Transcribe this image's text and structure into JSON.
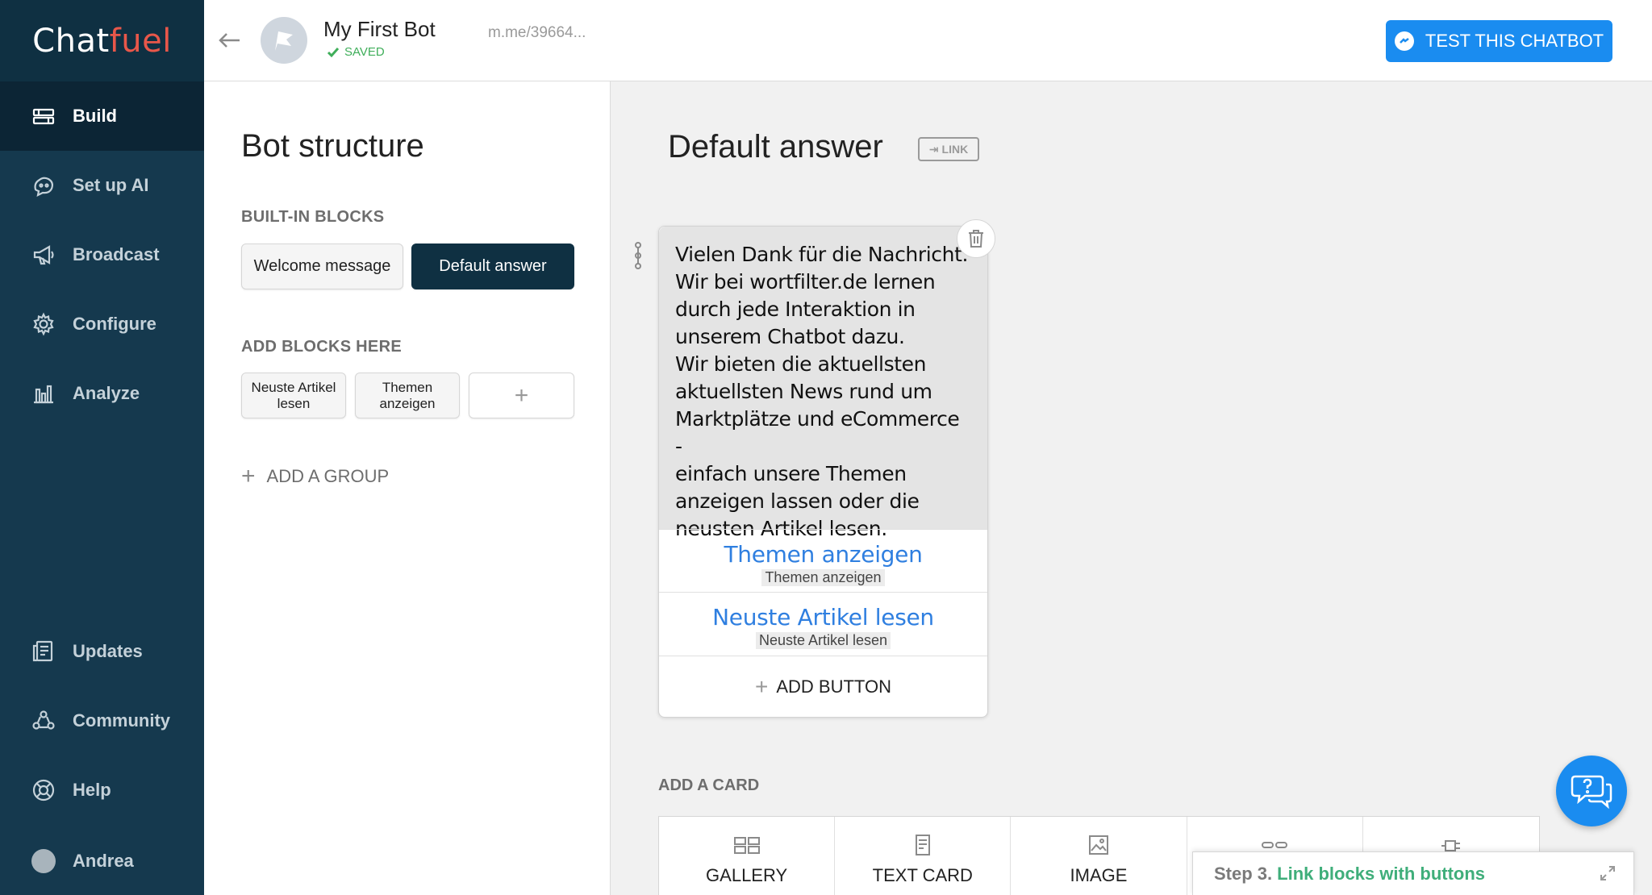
{
  "app": {
    "logo_main": "Chat",
    "logo_accent": "fuel"
  },
  "sidebar": {
    "items": [
      {
        "label": "Build",
        "icon": "build-icon",
        "active": true
      },
      {
        "label": "Set up AI",
        "icon": "ai-icon"
      },
      {
        "label": "Broadcast",
        "icon": "megaphone-icon"
      },
      {
        "label": "Configure",
        "icon": "gear-icon"
      },
      {
        "label": "Analyze",
        "icon": "bar-chart-icon"
      }
    ],
    "bottom_items": [
      {
        "label": "Updates",
        "icon": "updates-icon"
      },
      {
        "label": "Community",
        "icon": "community-icon"
      },
      {
        "label": "Help",
        "icon": "lifebuoy-icon"
      },
      {
        "label": "Andrea",
        "icon": "user-avatar"
      }
    ]
  },
  "header": {
    "bot_name": "My First Bot",
    "status": "SAVED",
    "bot_link": "m.me/39664...",
    "test_button": "TEST THIS CHATBOT"
  },
  "structure": {
    "title": "Bot structure",
    "builtin_label": "BUILT-IN BLOCKS",
    "builtin_blocks": [
      "Welcome message",
      "Default answer"
    ],
    "add_label": "ADD BLOCKS HERE",
    "custom_blocks": [
      {
        "line1": "Neuste Artikel",
        "line2": "lesen"
      },
      {
        "line1": "Themen",
        "line2": "anzeigen"
      }
    ],
    "add_block_symbol": "+",
    "add_group": "ADD A GROUP"
  },
  "main": {
    "title": "Default answer",
    "link_badge": "LINK",
    "card": {
      "text": "Vielen Dank für die Nachricht.\nWir bei wortfilter.de lernen\ndurch jede Interaktion in\nunserem Chatbot dazu.\nWir bieten die aktuellsten\naktuellsten News rund um\nMarktplätze und eCommerce -\neinfach unsere Themen\nanzeigen lassen oder die\nneusten Artikel lesen.",
      "buttons": [
        {
          "title": "Themen anzeigen",
          "target": "Themen anzeigen"
        },
        {
          "title": "Neuste Artikel lesen",
          "target": "Neuste Artikel lesen"
        }
      ],
      "add_button": "ADD BUTTON"
    },
    "add_card_label": "ADD A CARD",
    "card_types": [
      {
        "label": "GALLERY",
        "icon": "gallery-icon"
      },
      {
        "label": "TEXT CARD",
        "icon": "text-card-icon"
      },
      {
        "label": "IMAGE",
        "icon": "image-icon"
      },
      {
        "label": "",
        "icon": "quick-reply-icon"
      },
      {
        "label": "",
        "icon": "plugin-icon"
      }
    ]
  },
  "step_panel": {
    "step": "Step 3.",
    "text": "Link blocks with buttons"
  },
  "colors": {
    "sidebar_bg": "#15394e",
    "accent_blue": "#1a8cf0",
    "logo_accent": "#e8574a",
    "success_green": "#3fae5a"
  }
}
